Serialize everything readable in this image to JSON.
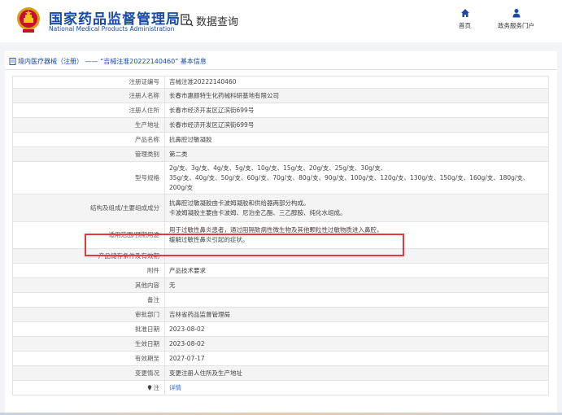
{
  "header": {
    "title_cn": "国家药品监督管理局",
    "title_en": "National Medical Products Administration",
    "query_label": "数据查询",
    "nav": [
      {
        "label": "首页",
        "icon": "home-icon"
      },
      {
        "label": "政务服务门户",
        "icon": "user-icon"
      }
    ]
  },
  "panel": {
    "title": "境内医疗器械（注册） —— “吉械注准20222140460” 基本信息"
  },
  "rows": [
    {
      "key": "注册证编号",
      "value": "吉械注准20222140460"
    },
    {
      "key": "注册人名称",
      "value": "长春市惠颜特生化药械科研基地有限公司"
    },
    {
      "key": "注册人住所",
      "value": "长春市经济开发区辽滨街699号"
    },
    {
      "key": "生产地址",
      "value": "长春市经济开发区辽滨街699号"
    },
    {
      "key": "产品名称",
      "value": "抗鼻腔过敏凝胶"
    },
    {
      "key": "管理类别",
      "value": "第二类"
    },
    {
      "key": "型号规格",
      "lines": [
        "2g/支、3g/支、4g/支、5g/支、10g/支、15g/支、20g/支、25g/支、30g/支、",
        "35g/支、40g/支、50g/支、60g/支、70g/支、80g/支、90g/支、100g/支、120g/支、130g/支、150g/支、160g/支、180g/支、",
        "200g/支"
      ]
    },
    {
      "key": "结构及组成/主要组成成分",
      "lines": [
        "抗鼻腔过敏凝胶由卡波姆凝胶和供给器两部分构成。",
        "卡波姆凝胶主要由卡波姆、尼泊金乙酯、三乙醇胺、纯化水组成。"
      ]
    },
    {
      "key": "适用范围/预期用途",
      "lines": [
        "用于过敏性鼻炎患者，通过阻隔致病性微生物及其他颗粒性过敏物质进入鼻腔，",
        "缓解过敏性鼻炎引起的症状。"
      ]
    },
    {
      "key": "产品储存条件及有效期",
      "value": ""
    },
    {
      "key": "附件",
      "value": "产品技术要求"
    },
    {
      "key": "其他内容",
      "value": "无"
    },
    {
      "key": "备注",
      "value": ""
    },
    {
      "key": "审批部门",
      "value": "吉林省药品监督管理局"
    },
    {
      "key": "批准日期",
      "value": "2023-08-02"
    },
    {
      "key": "生效日期",
      "value": "2023-08-02"
    },
    {
      "key": "有效期至",
      "value": "2027-07-17"
    },
    {
      "key": "变更情况",
      "value": "变更注册人住所及生产地址"
    },
    {
      "key": "注",
      "value": "详情"
    }
  ],
  "colors": {
    "brand_blue": "#1a4aa6",
    "link": "#2c6bd6",
    "highlight_border": "#e0393e"
  }
}
